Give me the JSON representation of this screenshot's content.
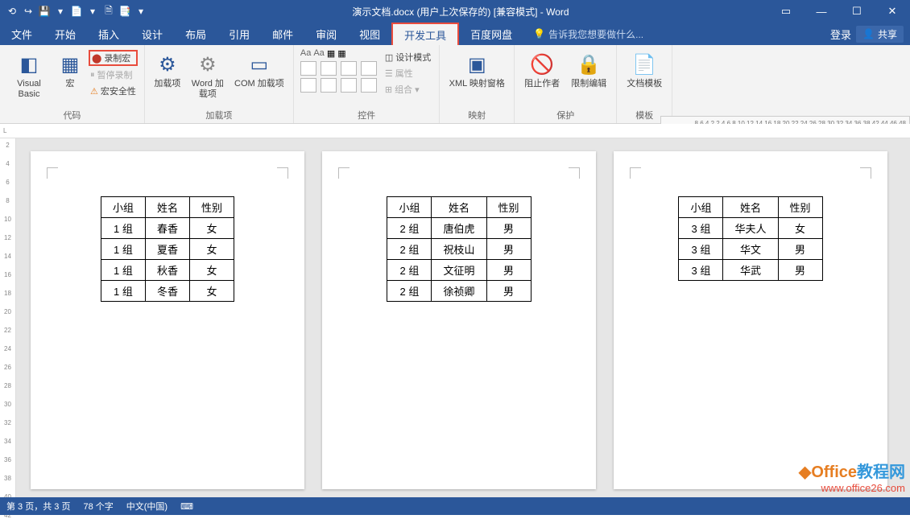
{
  "title": "演示文档.docx (用户上次保存的) [兼容模式] - Word",
  "qat": [
    "⟲",
    "↪",
    "💾",
    "▾",
    "📄",
    "▾",
    "🗎",
    "📑",
    "▾"
  ],
  "win": [
    "▭",
    "—",
    "☐",
    "✕"
  ],
  "tabs": [
    "文件",
    "开始",
    "插入",
    "设计",
    "布局",
    "引用",
    "邮件",
    "审阅",
    "视图",
    "开发工具",
    "百度网盘"
  ],
  "active_tab": "开发工具",
  "tellme_icon": "💡",
  "tellme": "告诉我您想要做什么...",
  "login": "登录",
  "share": "共享",
  "ribbon": {
    "code": {
      "vb": "Visual Basic",
      "macro": "宏",
      "record": "录制宏",
      "pause": "暂停录制",
      "security": "宏安全性",
      "label": "代码"
    },
    "addins": {
      "addin": "加载项",
      "word_addin": "Word 加载项",
      "com_addin": "COM 加载项",
      "label": "加载项"
    },
    "controls": {
      "designmode": "设计模式",
      "properties": "属性",
      "group": "组合",
      "label": "控件"
    },
    "mapping": {
      "xml": "XML 映射窗格",
      "label": "映射"
    },
    "protect": {
      "block": "阻止作者",
      "restrict": "限制编辑",
      "label": "保护"
    },
    "template": {
      "tpl": "文档模板",
      "label": "模板"
    }
  },
  "ruler_v": [
    "2",
    "4",
    "6",
    "8",
    "10",
    "12",
    "14",
    "16",
    "18",
    "20",
    "22",
    "24",
    "26",
    "28",
    "30",
    "32",
    "34",
    "36",
    "38",
    "40",
    "42"
  ],
  "nav_ticks": "8 6 4 2  2 4 6 8 10 12 14 16 18 20 22 24 26 28 30 32 34 36 38  42 44 46 48",
  "tables": [
    {
      "header": [
        "小组",
        "姓名",
        "性别"
      ],
      "rows": [
        [
          "1 组",
          "春香",
          "女"
        ],
        [
          "1 组",
          "夏香",
          "女"
        ],
        [
          "1 组",
          "秋香",
          "女"
        ],
        [
          "1 组",
          "冬香",
          "女"
        ]
      ]
    },
    {
      "header": [
        "小组",
        "姓名",
        "性别"
      ],
      "rows": [
        [
          "2 组",
          "唐伯虎",
          "男"
        ],
        [
          "2 组",
          "祝枝山",
          "男"
        ],
        [
          "2 组",
          "文征明",
          "男"
        ],
        [
          "2 组",
          "徐祯卿",
          "男"
        ]
      ]
    },
    {
      "header": [
        "小组",
        "姓名",
        "性别"
      ],
      "rows": [
        [
          "3 组",
          "华夫人",
          "女"
        ],
        [
          "3 组",
          "华文",
          "男"
        ],
        [
          "3 组",
          "华武",
          "男"
        ]
      ]
    }
  ],
  "status": {
    "page": "第 3 页，共 3 页",
    "words": "78 个字",
    "lang": "中文(中国)",
    "ime": "⌨"
  },
  "watermark": {
    "l1a": "Office",
    "l1b": "教程网",
    "l2": "www.office26.com"
  }
}
